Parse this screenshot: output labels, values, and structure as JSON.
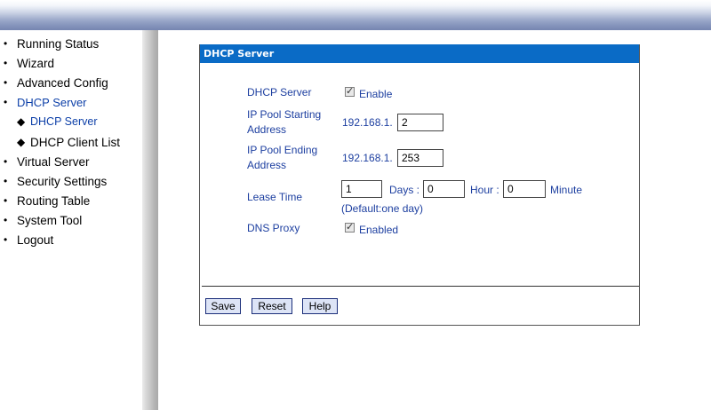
{
  "nav": {
    "items": [
      {
        "label": "Running Status"
      },
      {
        "label": "Wizard"
      },
      {
        "label": "Advanced Config"
      },
      {
        "label": "DHCP Server"
      },
      {
        "label": "DHCP Server"
      },
      {
        "label": "DHCP Client List"
      },
      {
        "label": "Virtual Server"
      },
      {
        "label": "Security Settings"
      },
      {
        "label": "Routing Table"
      },
      {
        "label": "System Tool"
      },
      {
        "label": "Logout"
      }
    ]
  },
  "panel": {
    "title": "DHCP Server",
    "dhcp_server_label": "DHCP Server",
    "enable_label": "Enable",
    "enable_checked": true,
    "pool_start_label_1": "IP Pool Starting",
    "pool_start_label_2": "Address",
    "pool_start_prefix": "192.168.1.",
    "pool_start_value": "2",
    "pool_end_label_1": "IP Pool Ending",
    "pool_end_label_2": "Address",
    "pool_end_prefix": "192.168.1.",
    "pool_end_value": "253",
    "lease_label": "Lease Time",
    "lease_days_value": "1",
    "days_label": "Days :",
    "lease_hours_value": "0",
    "hour_label": "Hour :",
    "lease_minutes_value": "0",
    "minute_label": "Minute",
    "lease_default": "(Default:one day)",
    "dns_proxy_label": "DNS Proxy",
    "enabled_label": "Enabled",
    "dns_proxy_checked": true
  },
  "buttons": {
    "save": "Save",
    "reset": "Reset",
    "help": "Help"
  },
  "colors": {
    "title_bar": "#0a6bc6",
    "label_text": "#1d3fa0",
    "button_bg": "#dde4f6"
  }
}
